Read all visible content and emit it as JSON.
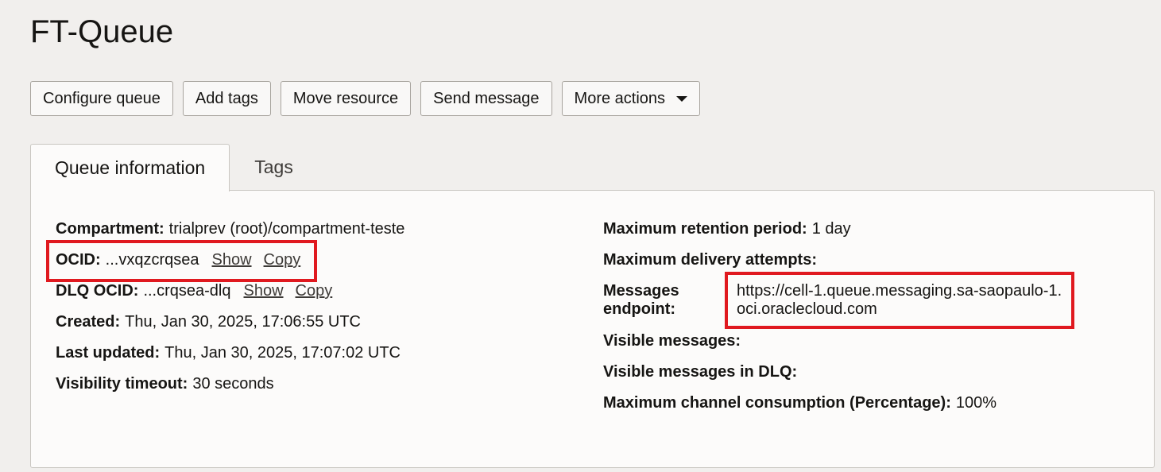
{
  "page": {
    "title": "FT-Queue"
  },
  "toolbar": {
    "configure_label": "Configure queue",
    "add_tags_label": "Add tags",
    "move_label": "Move resource",
    "send_label": "Send message",
    "more_label": "More actions"
  },
  "tabs": [
    {
      "label": "Queue information",
      "active": true
    },
    {
      "label": "Tags",
      "active": false
    }
  ],
  "info_left": {
    "compartment": {
      "label": "Compartment:",
      "value": "trialprev (root)/compartment-teste"
    },
    "ocid": {
      "label": "OCID:",
      "value": "...vxqzcrqsea",
      "show": "Show",
      "copy": "Copy"
    },
    "dlq_ocid": {
      "label": "DLQ OCID:",
      "value": "...crqsea-dlq",
      "show": "Show",
      "copy": "Copy"
    },
    "created": {
      "label": "Created:",
      "value": "Thu, Jan 30, 2025, 17:06:55 UTC"
    },
    "updated": {
      "label": "Last updated:",
      "value": "Thu, Jan 30, 2025, 17:07:02 UTC"
    },
    "visibility": {
      "label": "Visibility timeout:",
      "value": "30 seconds"
    }
  },
  "info_right": {
    "retention": {
      "label": "Maximum retention period:",
      "value": "1 day"
    },
    "delivery": {
      "label": "Maximum delivery attempts:",
      "value": ""
    },
    "endpoint": {
      "label": "Messages endpoint:",
      "value": "https://cell-1.queue.messaging.sa-saopaulo-1.oci.oraclecloud.com"
    },
    "visible": {
      "label": "Visible messages:",
      "value": ""
    },
    "visible_dlq": {
      "label": "Visible messages in DLQ:",
      "value": ""
    },
    "consumption": {
      "label": "Maximum channel consumption (Percentage):",
      "value": "100%"
    }
  },
  "colors": {
    "highlight": "#e0191f",
    "background": "#f1efed",
    "panel": "#fcfbfa"
  }
}
